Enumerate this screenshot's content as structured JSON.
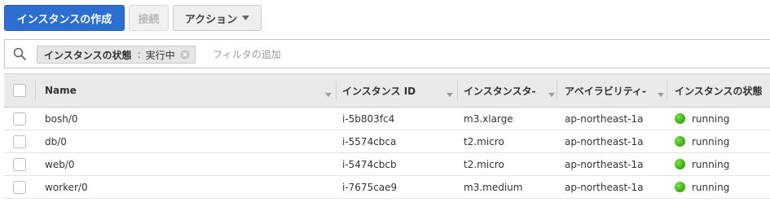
{
  "toolbar": {
    "launch_label": "インスタンスの作成",
    "connect_label": "接続",
    "actions_label": "アクション"
  },
  "filter": {
    "token_key": "インスタンスの状態",
    "token_separator": ":",
    "token_value": "実行中",
    "placeholder": "フィルタの追加"
  },
  "table": {
    "columns": [
      {
        "label": "Name"
      },
      {
        "label": "インスタンス ID"
      },
      {
        "label": "インスタンスタ-"
      },
      {
        "label": "アベイラビリティ-"
      },
      {
        "label": "インスタンスの状態"
      }
    ],
    "rows": [
      {
        "name": "bosh/0",
        "id": "i-5b803fc4",
        "type": "m3.xlarge",
        "az": "ap-northeast-1a",
        "state": "running"
      },
      {
        "name": "db/0",
        "id": "i-5574cbca",
        "type": "t2.micro",
        "az": "ap-northeast-1a",
        "state": "running"
      },
      {
        "name": "web/0",
        "id": "i-5474cbcb",
        "type": "t2.micro",
        "az": "ap-northeast-1a",
        "state": "running"
      },
      {
        "name": "worker/0",
        "id": "i-7675cae9",
        "type": "m3.medium",
        "az": "ap-northeast-1a",
        "state": "running"
      }
    ]
  },
  "icons": {
    "search": "search-icon",
    "caret": "chevron-down-icon",
    "token_remove": "close-circle-icon",
    "sort": "sort-down-icon",
    "status": "status-dot-icon"
  },
  "colors": {
    "primary": "#2d6fd1",
    "running": "#3fb51a",
    "header_bg": "#eaeaea"
  }
}
